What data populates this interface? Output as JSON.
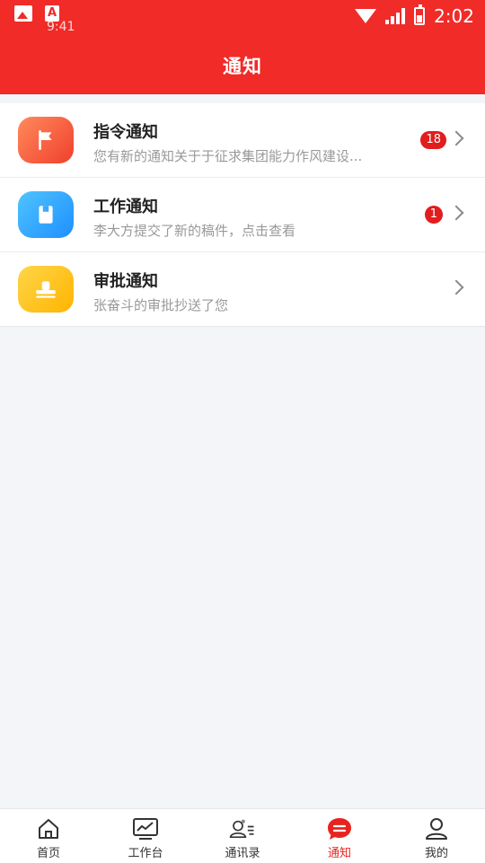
{
  "status_bar": {
    "time_small": "9:41",
    "clock": "2:02"
  },
  "header": {
    "title": "通知"
  },
  "notifications": [
    {
      "icon": "flag-icon",
      "title": "指令通知",
      "description": "您有新的通知关于于征求集团能力作风建设...",
      "badge": "18",
      "color": "#f0402c"
    },
    {
      "icon": "document-icon",
      "title": "工作通知",
      "description": "李大方提交了新的稿件，点击查看",
      "badge": "1",
      "color": "#1e8fff"
    },
    {
      "icon": "stamp-icon",
      "title": "审批通知",
      "description": "张奋斗的审批抄送了您",
      "badge": "",
      "color": "#ffb400"
    }
  ],
  "tabbar": {
    "items": [
      {
        "label": "首页",
        "icon": "home-icon",
        "active": false
      },
      {
        "label": "工作台",
        "icon": "chart-icon",
        "active": false
      },
      {
        "label": "通讯录",
        "icon": "contacts-icon",
        "active": false
      },
      {
        "label": "通知",
        "icon": "message-icon",
        "active": true
      },
      {
        "label": "我的",
        "icon": "user-icon",
        "active": false
      }
    ],
    "active_color": "#e8231f"
  }
}
